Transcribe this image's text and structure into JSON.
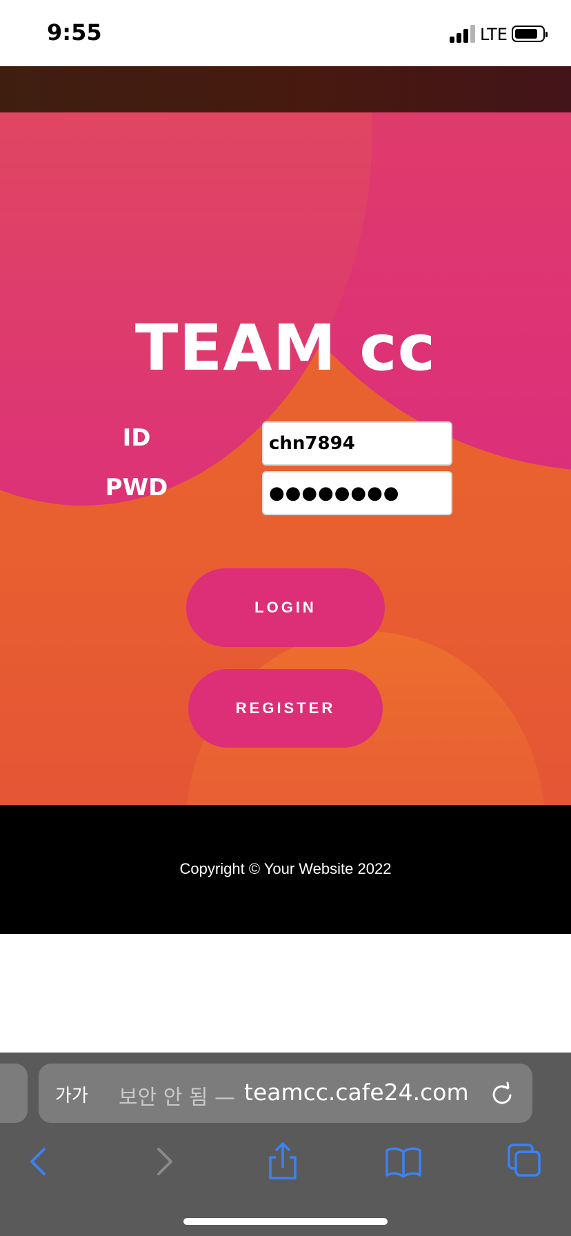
{
  "status_bar": {
    "time": "9:55",
    "network": "LTE",
    "icons": [
      "cellular-signal-icon",
      "battery-icon"
    ]
  },
  "page": {
    "brand_title": "TEAM cc",
    "form": {
      "id_label": "ID",
      "id_value": "chn7894",
      "pwd_label": "PWD",
      "pwd_masked": "●●●●●●●●"
    },
    "buttons": {
      "login": "LOGIN",
      "register": "REGISTER"
    },
    "footer": {
      "copyright": "Copyright © Your Website 2022"
    }
  },
  "browser": {
    "text_size_label": "가가",
    "security_note": "보안 안 됨 —",
    "domain": "teamcc.cafe24.com",
    "toolbar_icons": [
      "back-icon",
      "forward-icon",
      "share-icon",
      "bookmarks-icon",
      "tabs-icon",
      "reload-icon"
    ]
  },
  "colors": {
    "hero_orange": "#e9672e",
    "hero_pink": "#dc2f78",
    "button_pink": "#dc2f78",
    "footer_black": "#000000",
    "safari_chrome": "#5a5a5a",
    "toolbar_blue": "#3b82f6"
  }
}
